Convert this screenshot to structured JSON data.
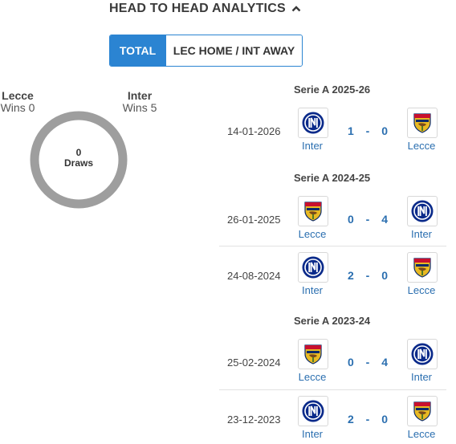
{
  "header": {
    "title": "HEAD TO HEAD ANALYTICS",
    "chevron_icon": "chevron-up-icon"
  },
  "tabs": [
    {
      "label": "TOTAL",
      "active": true
    },
    {
      "label": "LEC HOME / INT AWAY",
      "active": false
    }
  ],
  "summary": {
    "home": {
      "name": "Lecce",
      "wins": "Wins 0"
    },
    "away": {
      "name": "Inter",
      "wins": "Wins 5"
    },
    "draws_count": "0",
    "draws_label": "Draws",
    "donut_color": "#9e9e9e"
  },
  "colors": {
    "accent": "#2b84d2",
    "link": "#2b6fb0",
    "inter_blue": "#0a2a8a",
    "lecce_yellow": "#e8b923",
    "lecce_red": "#c8102e"
  },
  "seasons": [
    {
      "title": "Serie A 2025-26",
      "matches": [
        {
          "date": "14-01-2026",
          "home": "Inter",
          "away": "Lecce",
          "home_goals": "1",
          "sep": "-",
          "away_goals": "0"
        }
      ]
    },
    {
      "title": "Serie A 2024-25",
      "matches": [
        {
          "date": "26-01-2025",
          "home": "Lecce",
          "away": "Inter",
          "home_goals": "0",
          "sep": "-",
          "away_goals": "4"
        },
        {
          "date": "24-08-2024",
          "home": "Inter",
          "away": "Lecce",
          "home_goals": "2",
          "sep": "-",
          "away_goals": "0"
        }
      ]
    },
    {
      "title": "Serie A 2023-24",
      "matches": [
        {
          "date": "25-02-2024",
          "home": "Lecce",
          "away": "Inter",
          "home_goals": "0",
          "sep": "-",
          "away_goals": "4"
        },
        {
          "date": "23-12-2023",
          "home": "Inter",
          "away": "Lecce",
          "home_goals": "2",
          "sep": "-",
          "away_goals": "0"
        }
      ]
    }
  ]
}
